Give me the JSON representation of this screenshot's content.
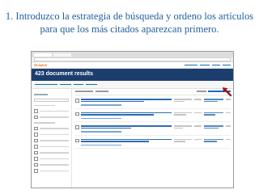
{
  "page": {
    "title_line1": "1. Introduzco la estrategia de búsqueda y ordeno los artículos",
    "title_line2": "para que los más citados aparezcan primero."
  },
  "scopus": {
    "logo": "Scopus",
    "results_count": "423 document results"
  },
  "colors": {
    "title": "#1f5f9e",
    "banner": "#1c3e6e",
    "logo": "#e87722",
    "link": "#0a6eb4",
    "arrow": "#a01818"
  },
  "icons": {
    "pointer": "red-arrow-icon"
  }
}
